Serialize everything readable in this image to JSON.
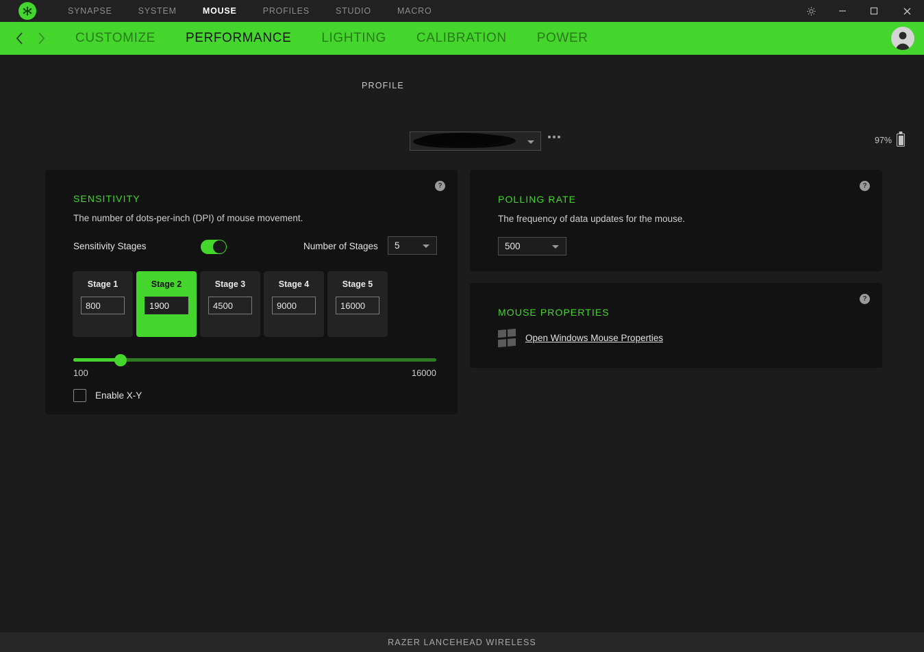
{
  "titlebar": {
    "logo_name": "razer-logo",
    "tabs": [
      {
        "label": "SYNAPSE",
        "active": false
      },
      {
        "label": "SYSTEM",
        "active": false
      },
      {
        "label": "MOUSE",
        "active": true
      },
      {
        "label": "PROFILES",
        "active": false
      },
      {
        "label": "STUDIO",
        "active": false
      },
      {
        "label": "MACRO",
        "active": false
      }
    ],
    "settings_icon": "gear-icon",
    "minimize_icon": "minimize-icon",
    "maximize_icon": "maximize-icon",
    "close_icon": "close-icon"
  },
  "subnav": {
    "back_icon": "chevron-left-icon",
    "forward_icon": "chevron-right-icon",
    "tabs": [
      {
        "label": "CUSTOMIZE",
        "active": false
      },
      {
        "label": "PERFORMANCE",
        "active": true
      },
      {
        "label": "LIGHTING",
        "active": false
      },
      {
        "label": "CALIBRATION",
        "active": false
      },
      {
        "label": "POWER",
        "active": false
      }
    ],
    "avatar_name": "user-avatar"
  },
  "profile_bar": {
    "label": "PROFILE",
    "selected_profile": "",
    "selected_profile_redacted": true,
    "more_options_label": "•••",
    "battery_percent": "97%"
  },
  "sensitivity": {
    "title": "SENSITIVITY",
    "description": "The number of dots-per-inch (DPI) of mouse movement.",
    "help_glyph": "?",
    "stages_toggle_label": "Sensitivity Stages",
    "stages_toggle_on": true,
    "number_of_stages_label": "Number of Stages",
    "number_of_stages_value": "5",
    "stages": [
      {
        "name": "Stage 1",
        "dpi": "800",
        "active": false
      },
      {
        "name": "Stage 2",
        "dpi": "1900",
        "active": true
      },
      {
        "name": "Stage 3",
        "dpi": "4500",
        "active": false
      },
      {
        "name": "Stage 4",
        "dpi": "9000",
        "active": false
      },
      {
        "name": "Stage 5",
        "dpi": "16000",
        "active": false
      }
    ],
    "slider_min": "100",
    "slider_max": "16000",
    "slider_value": "1900",
    "slider_fill_percent": "13",
    "enable_xy_label": "Enable X-Y",
    "enable_xy_checked": false
  },
  "polling_rate": {
    "title": "POLLING RATE",
    "description": "The frequency of data updates for the mouse.",
    "help_glyph": "?",
    "value": "500"
  },
  "mouse_properties": {
    "title": "MOUSE PROPERTIES",
    "help_glyph": "?",
    "windows_icon": "windows-logo-icon",
    "link_label": "Open Windows Mouse Properties"
  },
  "footer": {
    "device_name": "RAZER LANCEHEAD WIRELESS"
  },
  "colors": {
    "razer_green": "#44d62c",
    "window_bg": "#1c1c1c",
    "panel_bg": "#121212",
    "titlebar_bg": "#212121",
    "footer_bg": "#272727"
  }
}
